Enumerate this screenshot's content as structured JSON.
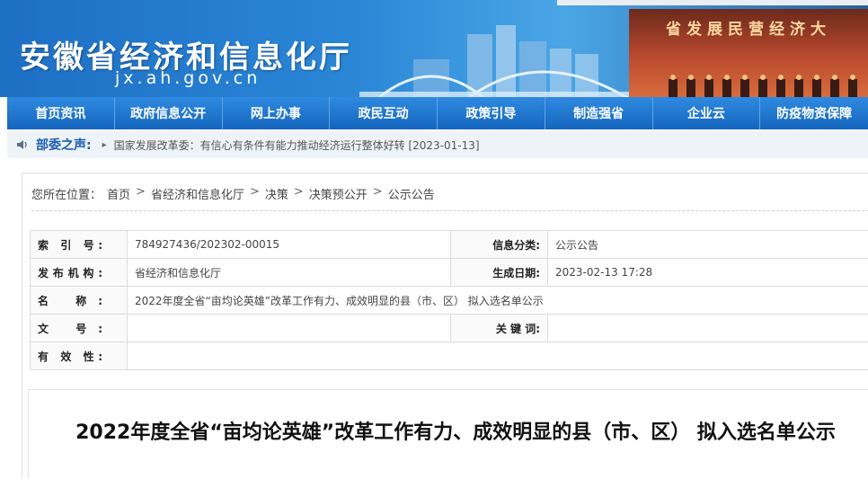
{
  "header": {
    "site_title": "安徽省经济和信息化厅",
    "domain": "jx.ah.gov.cn",
    "stage_slogan": "省发展民营经济大"
  },
  "nav": {
    "items": [
      {
        "label": "首页资讯"
      },
      {
        "label": "政府信息公开"
      },
      {
        "label": "网上办事"
      },
      {
        "label": "政民互动"
      },
      {
        "label": "政策引导"
      },
      {
        "label": "制造强省"
      },
      {
        "label": "企业云"
      },
      {
        "label": "防疫物资保障"
      }
    ]
  },
  "ticker": {
    "label": "部委之声:",
    "arrow": "▸",
    "text": "国家发展改革委：有信心有条件有能力推动经济运行整体好转 [2023-01-13]"
  },
  "breadcrumb": {
    "prefix": "您所在位置：",
    "items": [
      "首页",
      "省经济和信息化厅",
      "决策",
      "决策预公开",
      "公示公告"
    ],
    "separator": ">"
  },
  "info": {
    "index_label": "索 引 号:",
    "index_value": "784927436/202302-00015",
    "category_label": "信息分类:",
    "category_value": "公示公告",
    "issuer_label": "发布机构:",
    "issuer_value": "省经济和信息化厅",
    "date_label": "生成日期:",
    "date_value": "2023-02-13 17:28",
    "name_label": "名    称:",
    "name_value": "2022年度全省“亩均论英雄”改革工作有力、成效明显的县（市、区） 拟入选名单公示",
    "docno_label": "文    号:",
    "docno_value": "",
    "keywords_label": "关 键 词:",
    "keywords_value": "",
    "validity_label": "有 效 性:",
    "validity_value": ""
  },
  "article": {
    "title": "2022年度全省“亩均论英雄”改革工作有力、成效明显的县（市、区） 拟入选名单公示"
  },
  "colors": {
    "banner_blue": "#1e6fc4",
    "nav_blue": "#1565bd",
    "ticker_label": "#1a5fb0"
  }
}
